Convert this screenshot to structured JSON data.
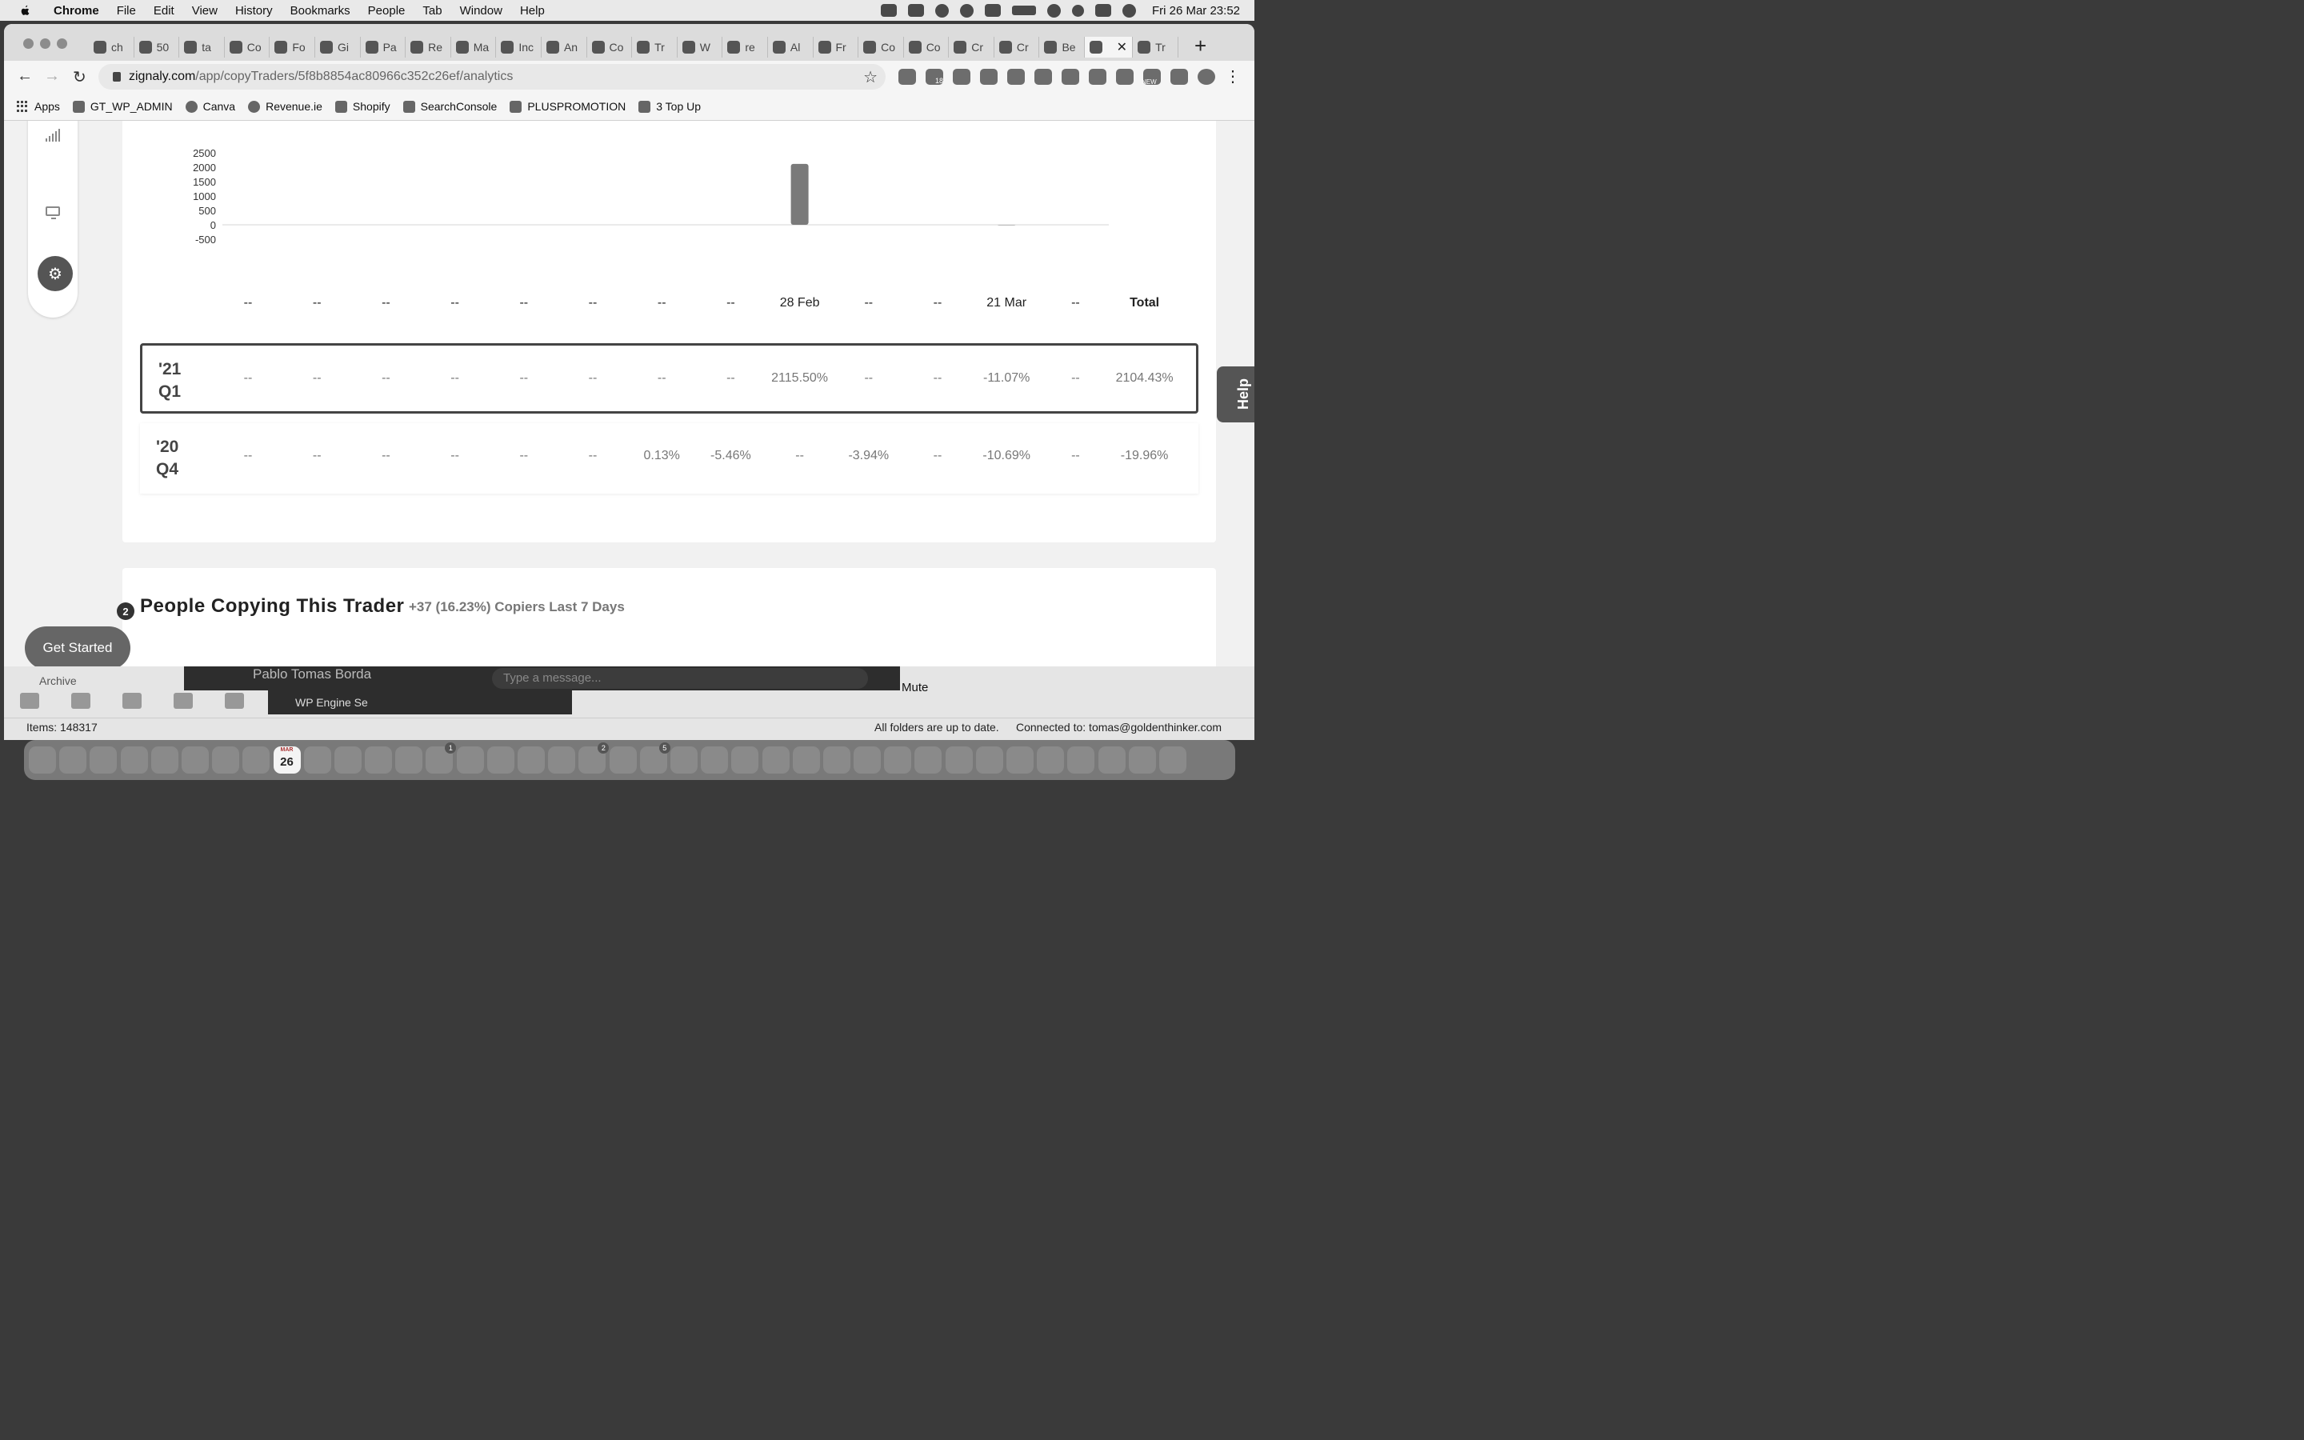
{
  "menubar": {
    "app": "Chrome",
    "items": [
      "File",
      "Edit",
      "View",
      "History",
      "Bookmarks",
      "People",
      "Tab",
      "Window",
      "Help"
    ],
    "clock": "Fri 26 Mar  23:52"
  },
  "browser": {
    "tabs": [
      {
        "label": "ch"
      },
      {
        "label": "50"
      },
      {
        "label": "ta"
      },
      {
        "label": "Co"
      },
      {
        "label": "Fo"
      },
      {
        "label": "Gi"
      },
      {
        "label": "Pa"
      },
      {
        "label": "Re"
      },
      {
        "label": "Ma"
      },
      {
        "label": "Inc"
      },
      {
        "label": "An"
      },
      {
        "label": "Co"
      },
      {
        "label": "Tr"
      },
      {
        "label": "W"
      },
      {
        "label": "re"
      },
      {
        "label": "Al"
      },
      {
        "label": "Fr"
      },
      {
        "label": "Co"
      },
      {
        "label": "Co"
      },
      {
        "label": "Cr"
      },
      {
        "label": "Cr"
      },
      {
        "label": "Be"
      },
      {
        "label": ""
      },
      {
        "label": "Tr"
      }
    ],
    "url_host": "zignaly.com",
    "url_path": "/app/copyTraders/5f8b8854ac80966c352c26ef/analytics",
    "extension_badges": {
      "ext_count": "18",
      "new_label": "NEW"
    },
    "bookmarks": [
      "Apps",
      "GT_WP_ADMIN",
      "Canva",
      "Revenue.ie",
      "Shopify",
      "SearchConsole",
      "PLUSPROMOTION",
      "3 Top Up"
    ]
  },
  "chart_data": {
    "type": "bar",
    "yticks": [
      2500,
      2000,
      1500,
      1000,
      500,
      0,
      -500
    ],
    "ylim": [
      -500,
      2500
    ],
    "grid": false,
    "categories": [
      "--",
      "--",
      "--",
      "--",
      "--",
      "--",
      "--",
      "--",
      "28 Feb",
      "--",
      "--",
      "21 Mar",
      "--"
    ],
    "values": [
      0,
      0,
      0,
      0,
      0,
      0,
      0,
      0,
      2115.5,
      0,
      0,
      -11.07,
      0
    ],
    "total_label": "Total"
  },
  "table": {
    "rows": [
      {
        "label_line1": "'21",
        "label_line2": "Q1",
        "cells": [
          "--",
          "--",
          "--",
          "--",
          "--",
          "--",
          "--",
          "--",
          "2115.50%",
          "--",
          "--",
          "-11.07%",
          "--"
        ],
        "total": "2104.43%",
        "selected": true
      },
      {
        "label_line1": "'20",
        "label_line2": "Q4",
        "cells": [
          "--",
          "--",
          "--",
          "--",
          "--",
          "--",
          "0.13%",
          "-5.46%",
          "--",
          "-3.94%",
          "--",
          "-10.69%",
          "--"
        ],
        "total": "-19.96%",
        "selected": false
      }
    ]
  },
  "copiers": {
    "title": "People Copying This Trader",
    "subtitle": "+37 (16.23%) Copiers Last 7 Days"
  },
  "get_started": {
    "label": "Get Started",
    "badge": "2"
  },
  "help": {
    "label": "Help"
  },
  "mail": {
    "archive_label": "Archive",
    "chat_name": "Pablo Tomas Borda",
    "chat_placeholder": "Type a message...",
    "mute_label": "Mute",
    "wp_engine_label": "WP Engine Se",
    "status_items": "Items: 148317",
    "status_sync": "All folders are up to date.",
    "status_connected": "Connected to: tomas@goldenthinker.com"
  },
  "dock": {
    "calendar_day": "26",
    "badges": {
      "tv": "1",
      "settings": "2",
      "outlook": "5"
    }
  }
}
